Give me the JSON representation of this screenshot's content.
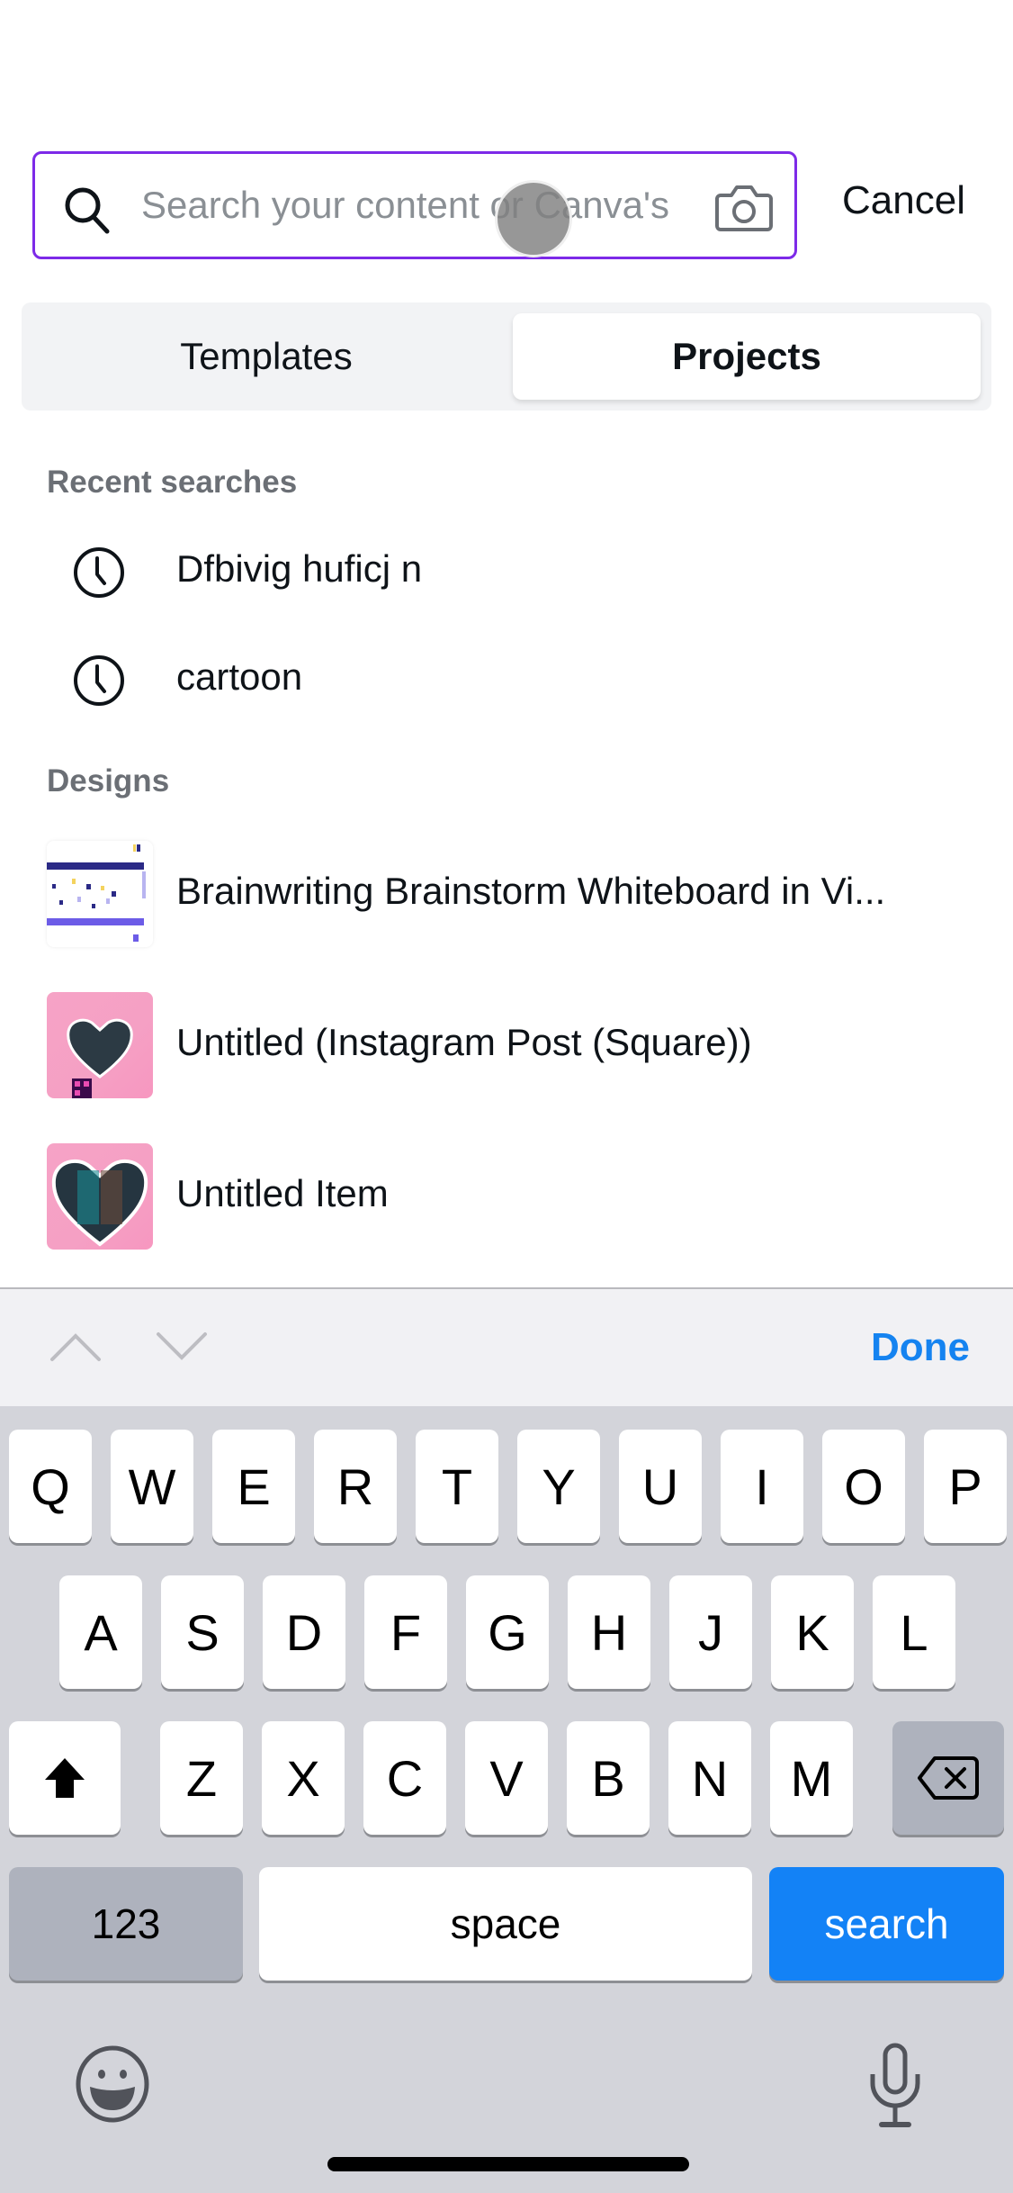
{
  "search": {
    "placeholder": "Search your content or Canva's",
    "cancel_label": "Cancel"
  },
  "tabs": [
    {
      "label": "Templates",
      "selected": false
    },
    {
      "label": "Projects",
      "selected": true
    }
  ],
  "recent": {
    "title": "Recent searches",
    "items": [
      "Dfbivig huficj n",
      "cartoon"
    ]
  },
  "designs": {
    "title": "Designs",
    "items": [
      {
        "title": "Brainwriting Brainstorm Whiteboard in Vi...",
        "thumbnail": "whiteboard"
      },
      {
        "title": "Untitled (Instagram Post (Square))",
        "thumbnail": "pink-heart-qr"
      },
      {
        "title": "Untitled Item",
        "thumbnail": "pink-heart"
      }
    ]
  },
  "keyboard": {
    "toolbar": {
      "done_label": "Done"
    },
    "row1": [
      "Q",
      "W",
      "E",
      "R",
      "T",
      "Y",
      "U",
      "I",
      "O",
      "P"
    ],
    "row2": [
      "A",
      "S",
      "D",
      "F",
      "G",
      "H",
      "J",
      "K",
      "L"
    ],
    "row3": [
      "Z",
      "X",
      "C",
      "V",
      "B",
      "N",
      "M"
    ],
    "numbers_label": "123",
    "space_label": "space",
    "search_label": "search"
  },
  "colors": {
    "accent": "#7d2ae8",
    "ios_blue": "#1382f6"
  }
}
